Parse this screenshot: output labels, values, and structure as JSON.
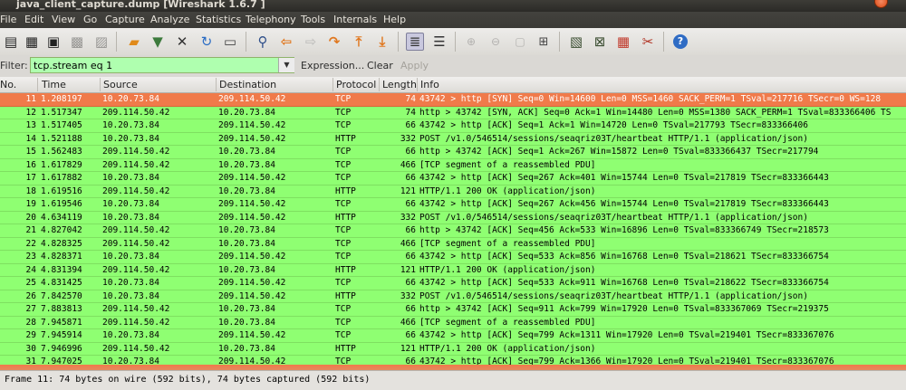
{
  "window": {
    "title": "java_client_capture.dump  [Wireshark 1.6.7 ]"
  },
  "menu": [
    "File",
    "Edit",
    "View",
    "Go",
    "Capture",
    "Analyze",
    "Statistics",
    "Telephony",
    "Tools",
    "Internals",
    "Help"
  ],
  "toolbar": {
    "icons": [
      "interface-list-icon",
      "capture-options-icon",
      "start-capture-icon",
      "stop-capture-icon",
      "restart-capture-icon",
      "open-file-icon",
      "save-file-icon",
      "close-file-icon",
      "reload-icon",
      "print-icon",
      "find-icon",
      "back-icon",
      "forward-icon",
      "goto-packet-icon",
      "go-first-icon",
      "go-last-icon",
      "colorize-icon",
      "autoscroll-icon",
      "zoom-in-icon",
      "zoom-out-icon",
      "normal-size-icon",
      "resize-columns-icon",
      "capture-filters-icon",
      "display-filters-icon",
      "coloring-rules-icon",
      "preferences-icon",
      "help-icon"
    ]
  },
  "filter": {
    "label": "Filter:",
    "value": "tcp.stream eq 1",
    "expression_label": "Expression...",
    "clear_label": "Clear",
    "apply_label": "Apply"
  },
  "packet_list": {
    "columns": [
      "No.",
      "Time",
      "Source",
      "Destination",
      "Protocol",
      "Length",
      "Info"
    ],
    "selected_no": "11",
    "rows": [
      {
        "no": "11",
        "time": "1.208197",
        "src": "10.20.73.84",
        "dst": "209.114.50.42",
        "proto": "TCP",
        "len": "74",
        "info": "43742 > http [SYN] Seq=0 Win=14600 Len=0 MSS=1460 SACK_PERM=1 TSval=217716 TSecr=0 WS=128"
      },
      {
        "no": "12",
        "time": "1.517347",
        "src": "209.114.50.42",
        "dst": "10.20.73.84",
        "proto": "TCP",
        "len": "74",
        "info": "http > 43742 [SYN, ACK] Seq=0 Ack=1 Win=14480 Len=0 MSS=1380 SACK_PERM=1 TSval=833366406 TS"
      },
      {
        "no": "13",
        "time": "1.517405",
        "src": "10.20.73.84",
        "dst": "209.114.50.42",
        "proto": "TCP",
        "len": "66",
        "info": "43742 > http [ACK] Seq=1 Ack=1 Win=14720 Len=0 TSval=217793 TSecr=833366406"
      },
      {
        "no": "14",
        "time": "1.521188",
        "src": "10.20.73.84",
        "dst": "209.114.50.42",
        "proto": "HTTP",
        "len": "332",
        "info": "POST /v1.0/546514/sessions/seaqriz03T/heartbeat HTTP/1.1  (application/json)"
      },
      {
        "no": "15",
        "time": "1.562483",
        "src": "209.114.50.42",
        "dst": "10.20.73.84",
        "proto": "TCP",
        "len": "66",
        "info": "http > 43742 [ACK] Seq=1 Ack=267 Win=15872 Len=0 TSval=833366437 TSecr=217794"
      },
      {
        "no": "16",
        "time": "1.617829",
        "src": "209.114.50.42",
        "dst": "10.20.73.84",
        "proto": "TCP",
        "len": "466",
        "info": "[TCP segment of a reassembled PDU]"
      },
      {
        "no": "17",
        "time": "1.617882",
        "src": "10.20.73.84",
        "dst": "209.114.50.42",
        "proto": "TCP",
        "len": "66",
        "info": "43742 > http [ACK] Seq=267 Ack=401 Win=15744 Len=0 TSval=217819 TSecr=833366443"
      },
      {
        "no": "18",
        "time": "1.619516",
        "src": "209.114.50.42",
        "dst": "10.20.73.84",
        "proto": "HTTP",
        "len": "121",
        "info": "HTTP/1.1 200 OK  (application/json)"
      },
      {
        "no": "19",
        "time": "1.619546",
        "src": "10.20.73.84",
        "dst": "209.114.50.42",
        "proto": "TCP",
        "len": "66",
        "info": "43742 > http [ACK] Seq=267 Ack=456 Win=15744 Len=0 TSval=217819 TSecr=833366443"
      },
      {
        "no": "20",
        "time": "4.634119",
        "src": "10.20.73.84",
        "dst": "209.114.50.42",
        "proto": "HTTP",
        "len": "332",
        "info": "POST /v1.0/546514/sessions/seaqriz03T/heartbeat HTTP/1.1  (application/json)"
      },
      {
        "no": "21",
        "time": "4.827042",
        "src": "209.114.50.42",
        "dst": "10.20.73.84",
        "proto": "TCP",
        "len": "66",
        "info": "http > 43742 [ACK] Seq=456 Ack=533 Win=16896 Len=0 TSval=833366749 TSecr=218573"
      },
      {
        "no": "22",
        "time": "4.828325",
        "src": "209.114.50.42",
        "dst": "10.20.73.84",
        "proto": "TCP",
        "len": "466",
        "info": "[TCP segment of a reassembled PDU]"
      },
      {
        "no": "23",
        "time": "4.828371",
        "src": "10.20.73.84",
        "dst": "209.114.50.42",
        "proto": "TCP",
        "len": "66",
        "info": "43742 > http [ACK] Seq=533 Ack=856 Win=16768 Len=0 TSval=218621 TSecr=833366754"
      },
      {
        "no": "24",
        "time": "4.831394",
        "src": "209.114.50.42",
        "dst": "10.20.73.84",
        "proto": "HTTP",
        "len": "121",
        "info": "HTTP/1.1 200 OK  (application/json)"
      },
      {
        "no": "25",
        "time": "4.831425",
        "src": "10.20.73.84",
        "dst": "209.114.50.42",
        "proto": "TCP",
        "len": "66",
        "info": "43742 > http [ACK] Seq=533 Ack=911 Win=16768 Len=0 TSval=218622 TSecr=833366754"
      },
      {
        "no": "26",
        "time": "7.842570",
        "src": "10.20.73.84",
        "dst": "209.114.50.42",
        "proto": "HTTP",
        "len": "332",
        "info": "POST /v1.0/546514/sessions/seaqriz03T/heartbeat HTTP/1.1  (application/json)"
      },
      {
        "no": "27",
        "time": "7.883813",
        "src": "209.114.50.42",
        "dst": "10.20.73.84",
        "proto": "TCP",
        "len": "66",
        "info": "http > 43742 [ACK] Seq=911 Ack=799 Win=17920 Len=0 TSval=833367069 TSecr=219375"
      },
      {
        "no": "28",
        "time": "7.945871",
        "src": "209.114.50.42",
        "dst": "10.20.73.84",
        "proto": "TCP",
        "len": "466",
        "info": "[TCP segment of a reassembled PDU]"
      },
      {
        "no": "29",
        "time": "7.945914",
        "src": "10.20.73.84",
        "dst": "209.114.50.42",
        "proto": "TCP",
        "len": "66",
        "info": "43742 > http [ACK] Seq=799 Ack=1311 Win=17920 Len=0 TSval=219401 TSecr=833367076"
      },
      {
        "no": "30",
        "time": "7.946996",
        "src": "209.114.50.42",
        "dst": "10.20.73.84",
        "proto": "HTTP",
        "len": "121",
        "info": "HTTP/1.1 200 OK  (application/json)"
      },
      {
        "no": "31",
        "time": "7.947025",
        "src": "10.20.73.84",
        "dst": "209.114.50.42",
        "proto": "TCP",
        "len": "66",
        "info": "43742 > http [ACK] Seq=799 Ack=1366 Win=17920 Len=0 TSval=219401 TSecr=833367076"
      }
    ]
  },
  "status": {
    "text": "Frame 11: 74 bytes on wire (592 bits), 74 bytes captured (592 bits)"
  },
  "colors": {
    "selected_row": "#f07a4a",
    "tcp_row": "#8fff72",
    "filter_ok": "#afffaf"
  }
}
